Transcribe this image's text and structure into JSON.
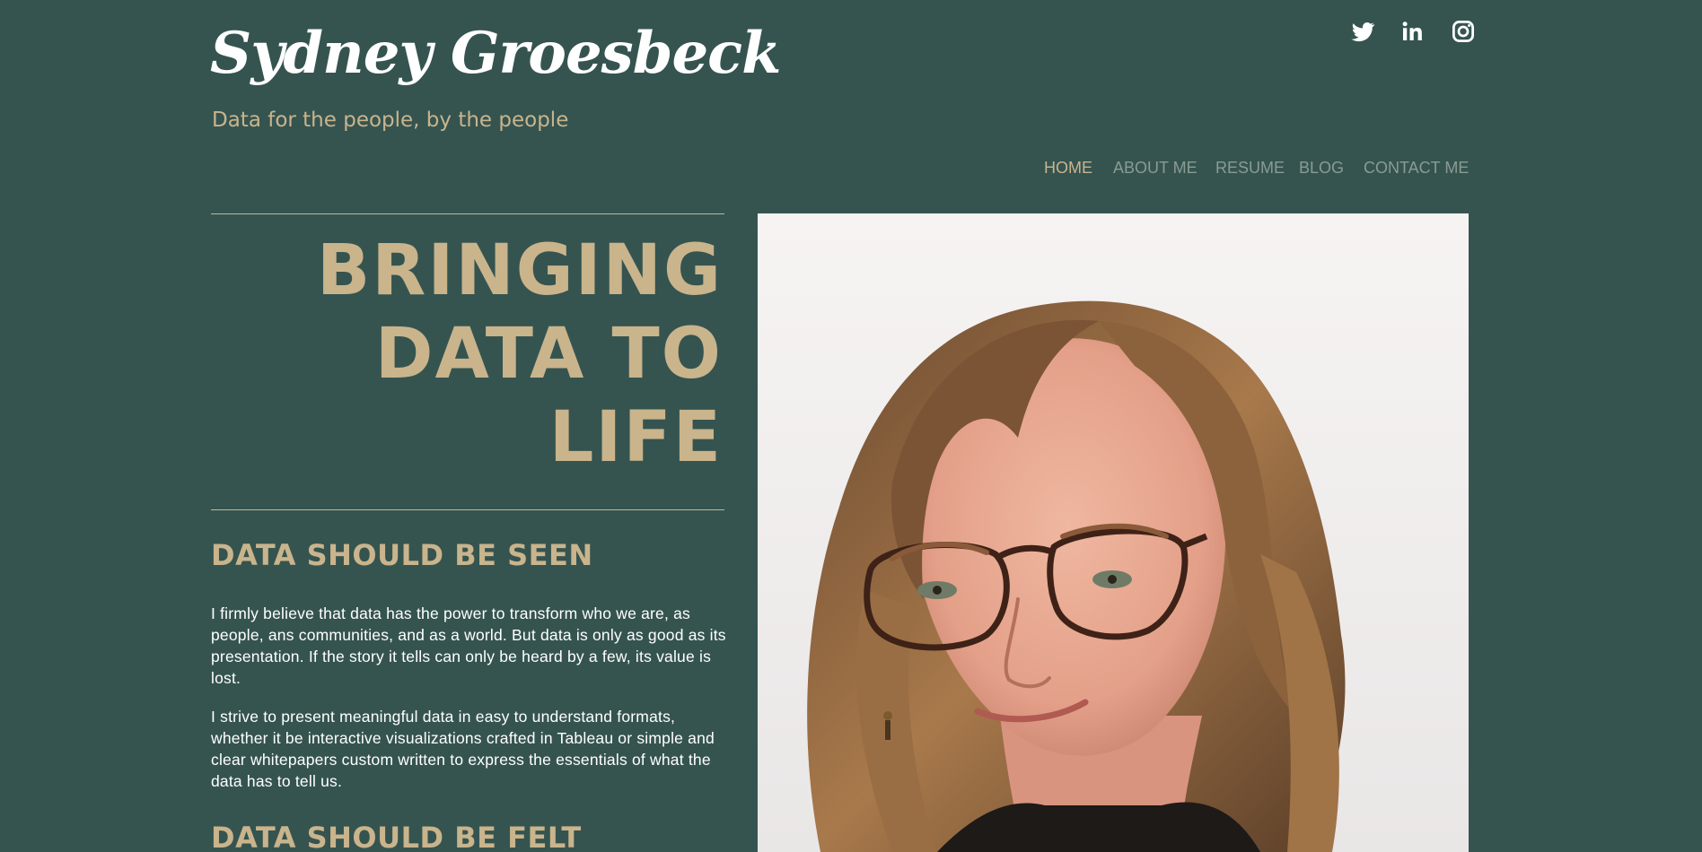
{
  "header": {
    "site_title": "Sydney Groesbeck",
    "tagline": "Data for the people, by the people"
  },
  "social": [
    {
      "icon": "twitter-icon"
    },
    {
      "icon": "linkedin-icon"
    },
    {
      "icon": "instagram-icon"
    }
  ],
  "nav": {
    "items": [
      {
        "label": "HOME",
        "active": true
      },
      {
        "label": "ABOUT ME",
        "active": false
      },
      {
        "label": "RESUME",
        "active": false
      },
      {
        "label": "BLOG",
        "active": false
      },
      {
        "label": "CONTACT ME",
        "active": false
      }
    ]
  },
  "hero": {
    "lines": [
      "BRINGING",
      "DATA TO",
      "LIFE"
    ]
  },
  "sections": [
    {
      "heading": "DATA SHOULD BE SEEN",
      "paragraphs": [
        "I firmly believe that data has the power to transform who we are, as people, ans communities, and as a world.  But data is only as good as its presentation.  If the story it tells can only be heard by a few, its value is lost.",
        "I strive to present meaningful data in easy to understand formats, whether it be interactive visualizations crafted in Tableau or simple and clear whitepapers custom written to express the essentials of what the data has to tell us."
      ]
    },
    {
      "heading": "DATA SHOULD BE FELT"
    }
  ],
  "colors": {
    "background": "#355450",
    "accent": "#c9b48c",
    "text": "#ffffff",
    "nav_inactive": "#8a9b92"
  }
}
